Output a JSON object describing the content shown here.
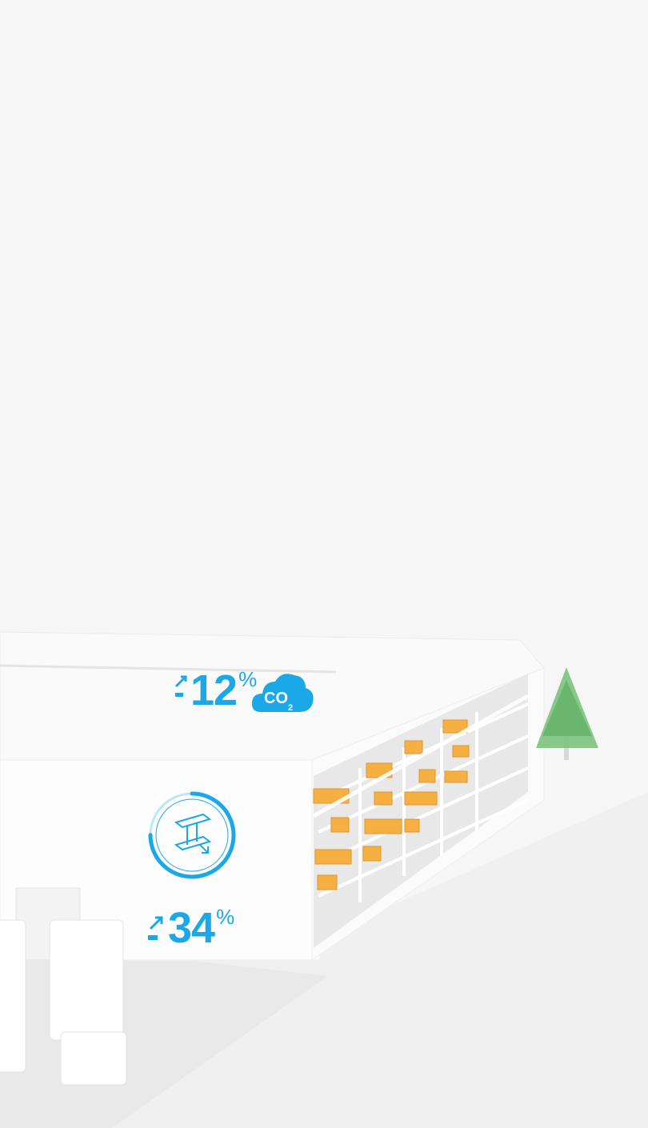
{
  "overlay": {
    "co2_reduction": {
      "value": "12",
      "unit": "%",
      "icon": "co2-cloud-icon",
      "trend": "down",
      "badge_text": "CO",
      "badge_subscript": "2"
    },
    "steel_savings": {
      "value": "34",
      "unit": "%",
      "icon": "steel-beam-icon",
      "trend": "up",
      "ring_progress": 0.34
    }
  },
  "colors": {
    "accent": "#1aa8e8",
    "background": "#f6f6f6",
    "box": "#f5b041",
    "tree": "#6fbf73"
  }
}
